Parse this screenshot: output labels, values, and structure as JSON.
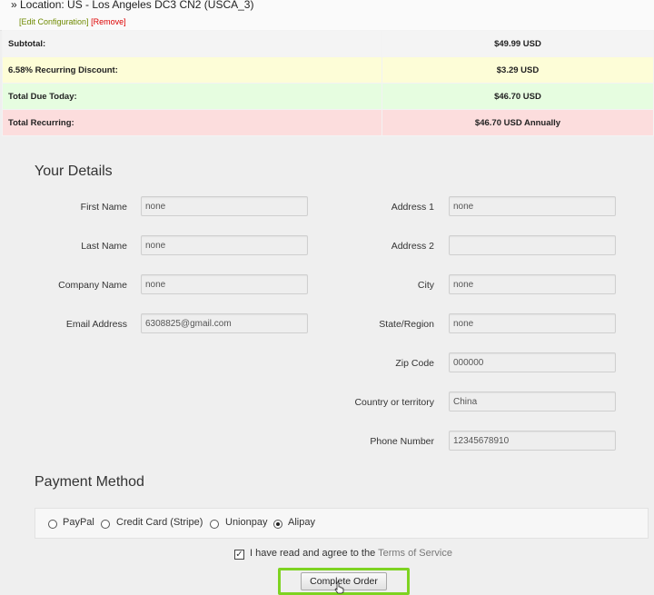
{
  "location_line": "» Location: US - Los Angeles DC3 CN2 (USCA_3)",
  "config_links": {
    "edit": "[Edit Configuration]",
    "remove": "[Remove]"
  },
  "summary": [
    {
      "label": "Subtotal:",
      "value": "$49.99 USD"
    },
    {
      "label": "6.58% Recurring Discount:",
      "value": "$3.29 USD"
    },
    {
      "label": "Total Due Today:",
      "value": "$46.70 USD"
    },
    {
      "label": "Total Recurring:",
      "value": "$46.70 USD Annually"
    }
  ],
  "details": {
    "title": "Your Details",
    "first_name": {
      "label": "First Name",
      "value": "none"
    },
    "last_name": {
      "label": "Last Name",
      "value": "none"
    },
    "company": {
      "label": "Company Name",
      "value": "none"
    },
    "email": {
      "label": "Email Address",
      "value": "6308825@gmail.com"
    },
    "address1": {
      "label": "Address 1",
      "value": "none"
    },
    "address2": {
      "label": "Address 2",
      "value": ""
    },
    "city": {
      "label": "City",
      "value": "none"
    },
    "state": {
      "label": "State/Region",
      "value": "none"
    },
    "zip": {
      "label": "Zip Code",
      "value": "000000"
    },
    "country": {
      "label": "Country or territory",
      "value": "China"
    },
    "phone": {
      "label": "Phone Number",
      "value": "12345678910"
    }
  },
  "payment": {
    "title": "Payment Method",
    "options": [
      "PayPal",
      "Credit Card (Stripe)",
      "Unionpay",
      "Alipay"
    ],
    "selected": "Alipay"
  },
  "agree": {
    "text": "I have read and agree to the ",
    "link": "Terms of Service",
    "checked": true
  },
  "submit_label": "Complete Order",
  "colors": {
    "accent_green": "#7ed321",
    "discount_bg": "#fdfdd7",
    "due_bg": "#e6fde0",
    "recurring_bg": "#fcdddd"
  }
}
